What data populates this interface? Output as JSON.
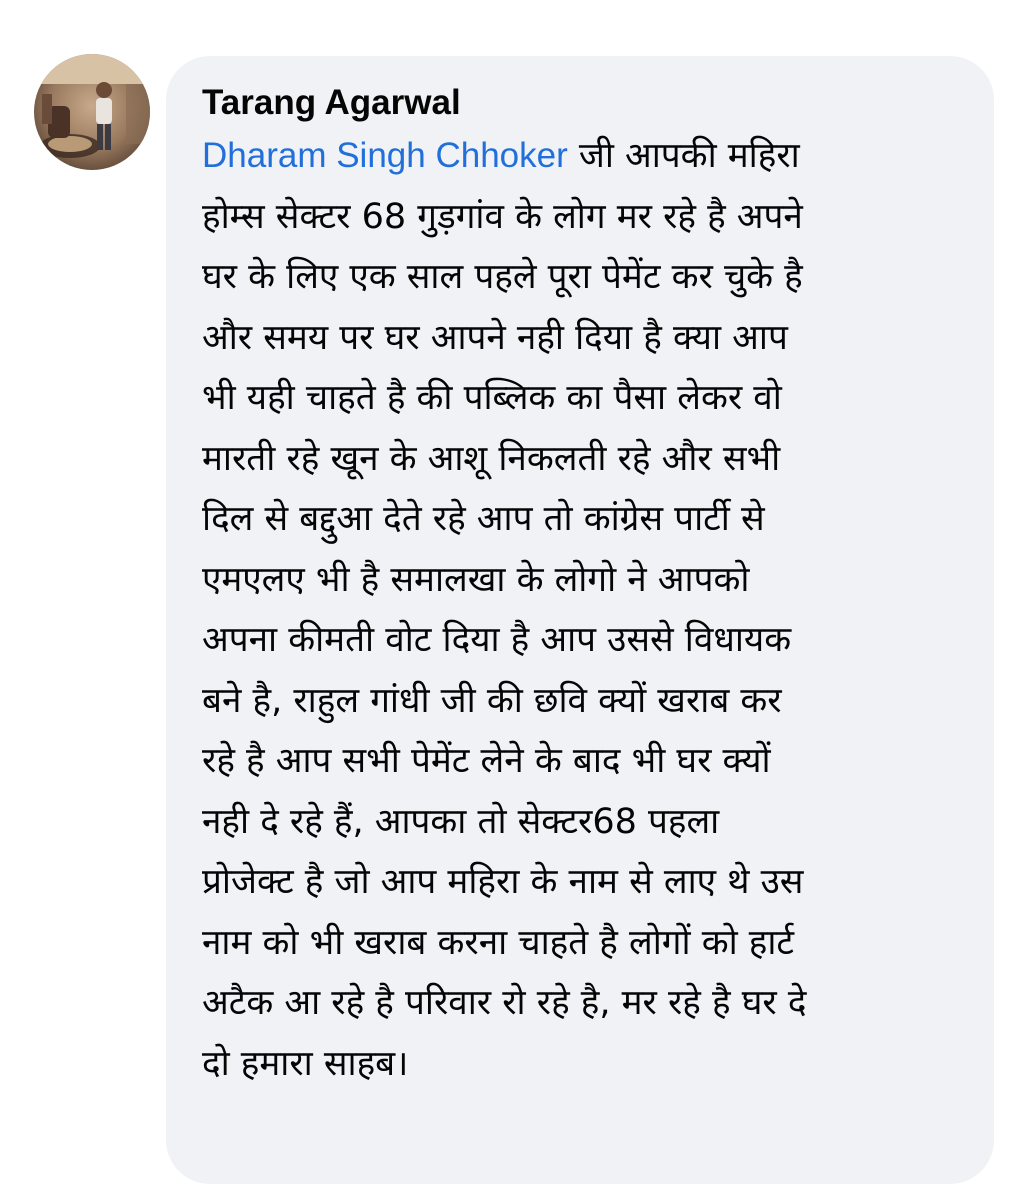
{
  "comment": {
    "author_name": "Tarang Agarwal",
    "mention_name": "Dharam Singh Chhoker",
    "text": " जी आपकी महिरा\nहोम्स सेक्टर 68 गुड़गांव के लोग मर रहे है अपने\nघर के लिए एक साल पहले पूरा पेमेंट कर चुके है\nऔर समय पर घर आपने नही दिया है क्या आप\nभी यही चाहते है की पब्लिक का पैसा लेकर वो\nमारती रहे खून के आशू निकलती रहे और सभी\nदिल से बद्दुआ देते रहे आप तो कांग्रेस पार्टी से\nएमएलए भी है समालखा के लोगो ने आपको\nअपना कीमती वोट दिया है आप उससे विधायक\nबने है, राहुल गांधी जी की छवि क्यों खराब कर\nरहे है आप सभी पेमेंट लेने के बाद भी घर क्यों\nनही दे रहे हैं, आपका तो सेक्टर68 पहला\nप्रोजेक्ट है जो आप महिरा के नाम से लाए थे उस\nनाम को भी खराब करना चाहते है लोगों को हार्ट\nअटैक आ रहे है परिवार रो रहे है, मर रहे है घर दे\nदो हमारा साहब।"
  },
  "colors": {
    "bubble_background": "#f0f2f5",
    "mention_link": "#216fdb",
    "text": "#050505"
  },
  "icons": {
    "avatar": "profile-photo"
  }
}
